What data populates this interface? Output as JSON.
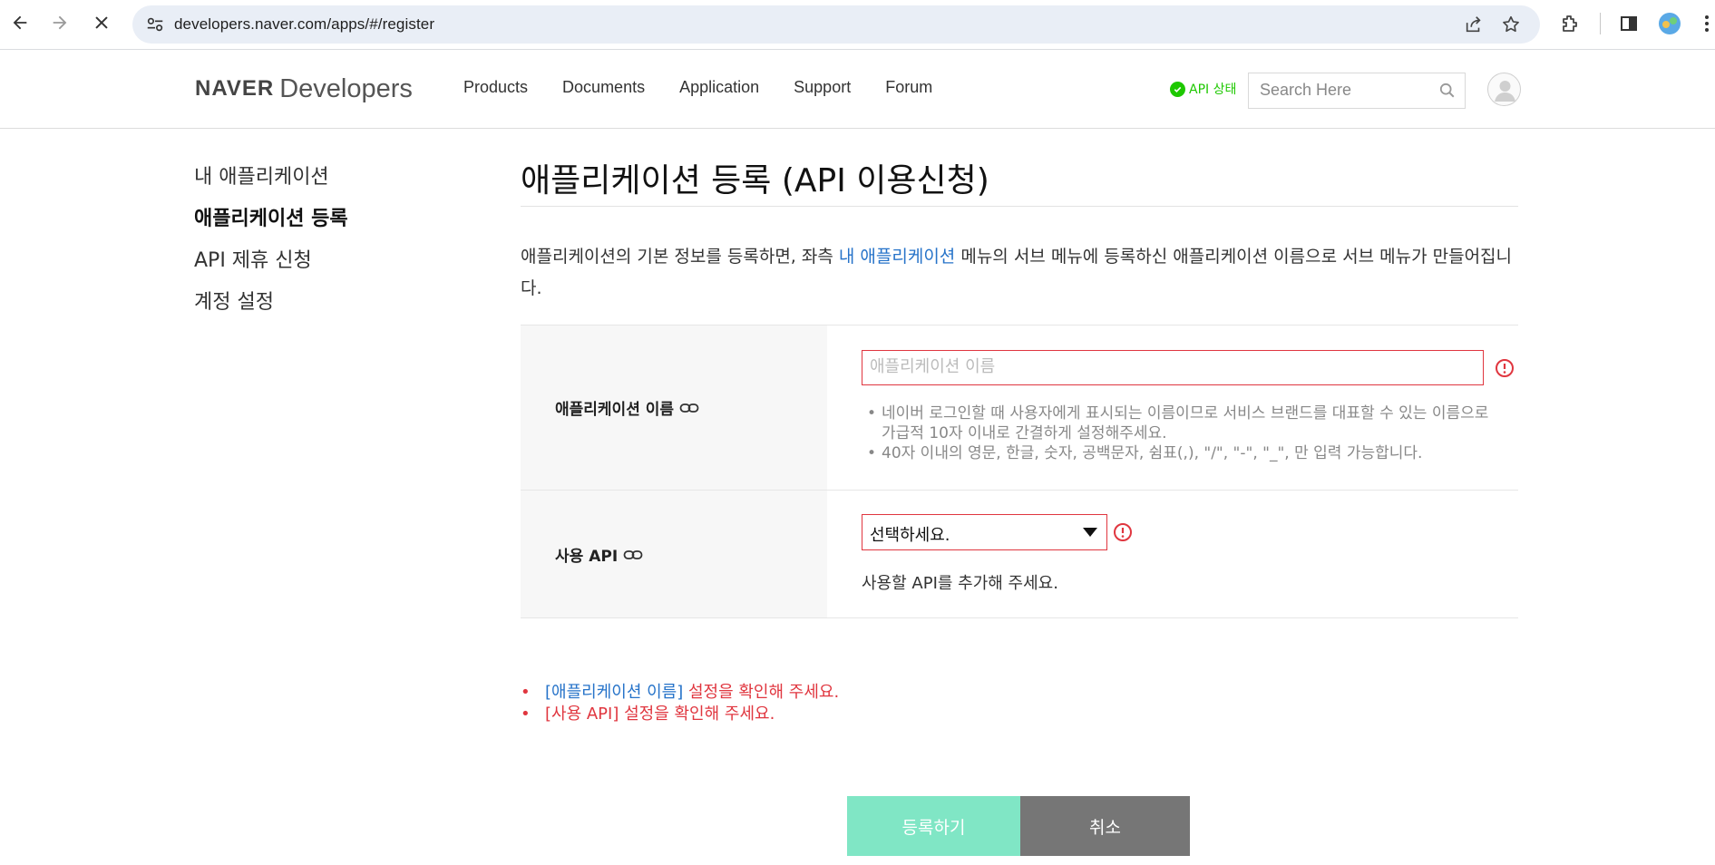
{
  "browser": {
    "url": "developers.naver.com/apps/#/register"
  },
  "header": {
    "logo_brand": "NAVER",
    "logo_product": "Developers",
    "nav": [
      {
        "label": "Products"
      },
      {
        "label": "Documents"
      },
      {
        "label": "Application"
      },
      {
        "label": "Support"
      },
      {
        "label": "Forum"
      }
    ],
    "api_status": "API 상태",
    "search_placeholder": "Search Here"
  },
  "sidebar": {
    "items": [
      {
        "label": "내 애플리케이션",
        "active": false
      },
      {
        "label": "애플리케이션 등록",
        "active": true
      },
      {
        "label": "API 제휴 신청",
        "active": false
      },
      {
        "label": "계정 설정",
        "active": false
      }
    ]
  },
  "main": {
    "title": "애플리케이션 등록 (API 이용신청)",
    "intro_before": "애플리케이션의 기본 정보를 등록하면, 좌측 ",
    "intro_link": "내 애플리케이션",
    "intro_after": " 메뉴의 서브 메뉴에 등록하신 애플리케이션 이름으로 서브 메뉴가 만들어집니다.",
    "form": {
      "app_name": {
        "label": "애플리케이션 이름",
        "placeholder": "애플리케이션 이름",
        "value": "",
        "help": [
          "네이버 로그인할 때 사용자에게 표시되는 이름이므로 서비스 브랜드를 대표할 수 있는 이름으로 가급적 10자 이내로 간결하게 설정해주세요.",
          "40자 이내의 영문, 한글, 숫자, 공백문자, 쉼표(,), \"/\", \"-\", \"_\", 만 입력 가능합니다."
        ]
      },
      "api": {
        "label": "사용 API",
        "selected": "선택하세요.",
        "hint": "사용할 API를 추가해 주세요."
      }
    },
    "errors": [
      {
        "field": "[애플리케이션 이름]",
        "message": " 설정을 확인해 주세요."
      },
      {
        "field": "[사용 API]",
        "message": " 설정을 확인해 주세요."
      }
    ],
    "buttons": {
      "submit": "등록하기",
      "cancel": "취소"
    }
  },
  "colors": {
    "error": "#e0363f",
    "link": "#2673c9",
    "submit_bg": "#80e6c5",
    "cancel_bg": "#767676",
    "status_green": "#1ec800"
  }
}
